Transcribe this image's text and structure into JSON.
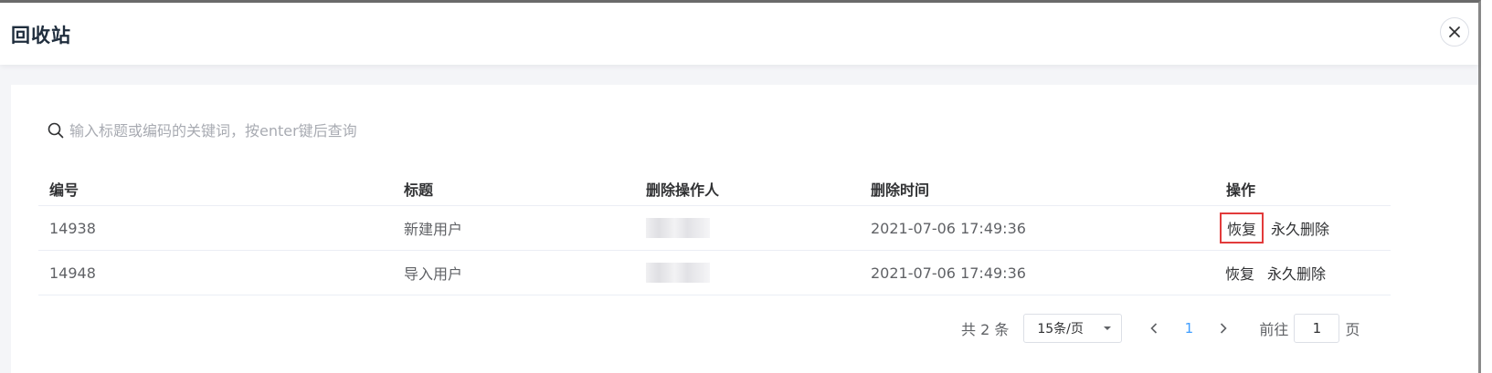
{
  "dialog": {
    "title": "回收站"
  },
  "search": {
    "placeholder": "输入标题或编码的关键词，按enter键后查询",
    "value": ""
  },
  "table": {
    "columns": [
      "编号",
      "标题",
      "删除操作人",
      "删除时间",
      "操作"
    ],
    "rows": [
      {
        "id": "14938",
        "title": "新建用户",
        "operator": "",
        "deleted_at": "2021-07-06 17:49:36",
        "restore": "恢复",
        "delete": "永久删除"
      },
      {
        "id": "14948",
        "title": "导入用户",
        "operator": "",
        "deleted_at": "2021-07-06 17:49:36",
        "restore": "恢复",
        "delete": "永久删除"
      }
    ]
  },
  "pagination": {
    "total": "共 2 条",
    "page_size": "15条/页",
    "current_page": "1",
    "goto_prefix": "前往",
    "goto_value": "1",
    "goto_suffix": "页"
  },
  "colors": {
    "highlight": "#e23b3b",
    "active_page": "#409eff"
  }
}
